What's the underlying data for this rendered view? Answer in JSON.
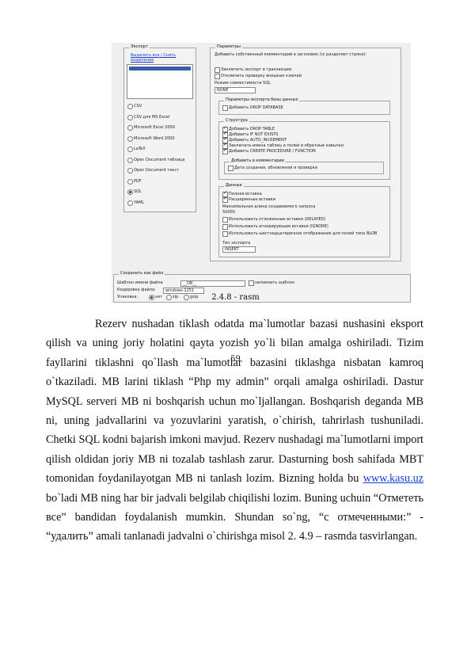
{
  "screenshot": {
    "export_group": "Экспорт",
    "select_all": "Выделить все / Снять выделение",
    "db_list_item": "",
    "formats": [
      "CSV",
      "CSV для MS Excel",
      "Microsoft Excel 2000",
      "Microsoft Word 2000",
      "LaTeX",
      "Open Document таблица",
      "Open Document текст",
      "PDF",
      "SQL",
      "YAML"
    ],
    "selected_format": "SQL",
    "params_group": "Параметры",
    "params_comment": "Добавить собственный комментарий в заголовок (\\n разделяет строки):",
    "enclose_transaction": "Заключить экспорт в транзакцию",
    "disable_fk": "Отключить проверку внешних ключей",
    "compat_label": "Режим совместимости SQL",
    "compat_value": "NONE",
    "struct_group": "Параметры экспорта базы данных",
    "drop_db": "Добавить DROP DATABASE",
    "structure_group": "Структура",
    "structure_options": [
      "Добавить DROP TABLE",
      "Добавить IF NOT EXISTS",
      "Добавить AUTO_INCREMENT",
      "Заключать имена таблиц и полей в обратные кавычки",
      "Добавить CREATE PROCEDURE / FUNCTION"
    ],
    "comments_group": "Добавить в комментарии",
    "comments_option": "Дата создания, обновления и проверки",
    "data_group": "Данные",
    "data_options": [
      "Полная вставка",
      "Расширенные вставки"
    ],
    "max_query_label": "Максимальная длина создаваемого запроса",
    "max_query_value": "50000",
    "data_options_2": [
      "Использовать отложенные вставки (DELAYED)",
      "Использовать игнорирующие вставки (IGNORE)",
      "Использовать шестнадцатеричное отображение для полей типа BLOB"
    ],
    "export_type_label": "Тип экспорта",
    "export_type_value": "INSERT",
    "save_group": "Сохранить как файл",
    "filename_label": "Шаблон имени файла",
    "filename_value": "__DB__",
    "remember_template": "запомнить шаблон",
    "charset_label": "Кодировка файла:",
    "charset_value": "windows-1251",
    "compression_label": "Упаковка:",
    "compression_options": [
      "нет",
      "zip",
      "gzip"
    ]
  },
  "caption": "2.4.8 - rasm",
  "paragraph_before_link": "Rezerv nushadan tiklash odatda ma`lumotlar bazasi nushasini eksport qilish va uning joriy holatini qayta yozish yo`li bilan amalga oshiriladi. Tizim fayllarini tiklashni qo`llash ma`lumotlar bazasini tiklashga nisbatan kamroq o`tkaziladi. MB larini tiklash “Php my admin” orqali amalga oshiriladi. Dastur MySQL serveri MB ni boshqarish uchun mo`ljallangan. Boshqarish deganda MB ni, uning jadvallarini va yozuvlarini yaratish, o`chirish, tahrirlash tushuniladi. Chetki SQL kodni bajarish imkoni mavjud. Rezerv nushadagi ma`lumotlarni import qilish oldidan joriy MB ni tozalab tashlash zarur. Dasturning bosh sahifada MBT tomonidan foydanilayotgan MB ni tanlash lozim. Bizning holda bu ",
  "link_text": "www.kasu.uz",
  "paragraph_after_link": " bo`ladi MB ning har bir jadvali belgilab chiqilishi lozim. Buning uchuin “Отмететь все” bandidan foydalanish mumkin. Shundan so`ng, “с отмеченными:” - “удалить” amali tanlanadi jadvalni o`chirishga misol 2. 4.9 – rasmda tasvirlangan.",
  "page_number": "59"
}
